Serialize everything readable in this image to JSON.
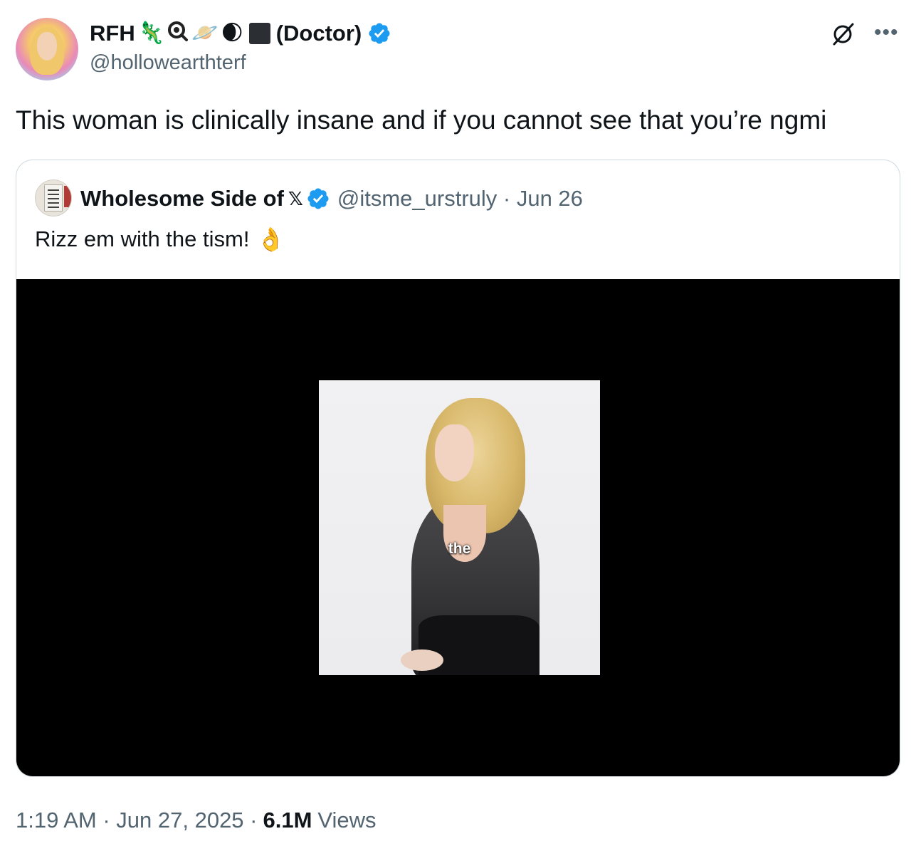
{
  "author": {
    "display_name": "RFH",
    "emojis": [
      "🦎",
      "🍳",
      "🪐",
      "🌒"
    ],
    "title_suffix": "(Doctor)",
    "handle": "@hollowearthterf",
    "verified": true
  },
  "tweet": {
    "text": "This woman is clinically insane and if you cannot see that you’re ngmi"
  },
  "quote": {
    "display_name": "Wholesome Side of",
    "handle_date": "@itsme_urstruly · Jun 26",
    "text": "Rizz em with the tism!",
    "emoji": "👌",
    "verified": true,
    "video_caption": "the"
  },
  "meta": {
    "time_date": "1:19 AM · Jun 27, 2025 ·",
    "views_count": "6.1M",
    "views_label": "Views"
  },
  "colors": {
    "verified_blue": "#1d9bf0",
    "secondary_text": "#536471",
    "primary_text": "#0f1419"
  },
  "icons": {
    "grok": "grok-icon",
    "more": "more-icon",
    "x_logo": "𝕏"
  }
}
